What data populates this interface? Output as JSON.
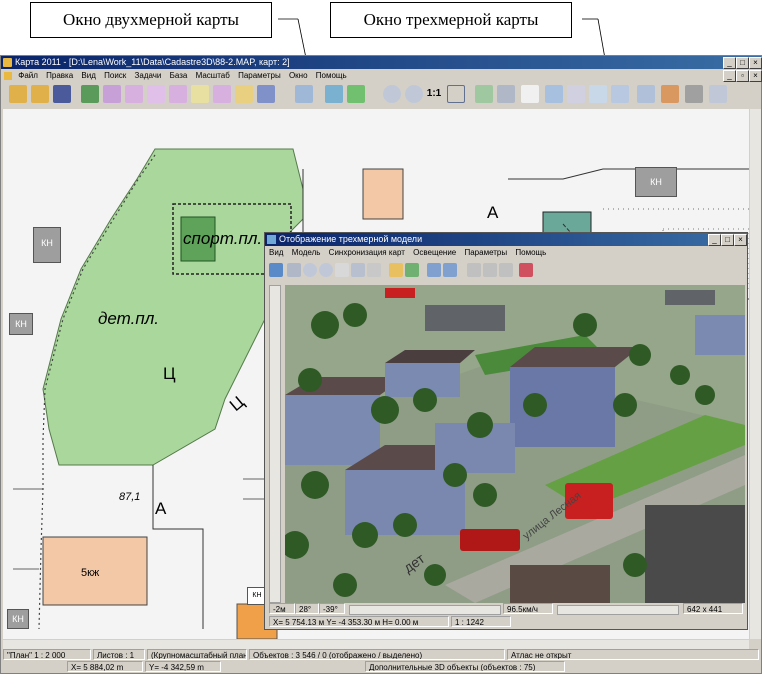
{
  "callouts": {
    "map2d": "Окно двухмерной карты",
    "map3d": "Окно трехмерной карты"
  },
  "main_window": {
    "title": "Карта 2011 - [D:\\Lena\\Work_11\\Data\\Cadastre3D\\88-2.MAP, карт: 2]",
    "menu": [
      "Файл",
      "Правка",
      "Вид",
      "Поиск",
      "Задачи",
      "База",
      "Масштаб",
      "Параметры",
      "Окно",
      "Помощь"
    ],
    "toolbar_scale_label": "1:1",
    "map_labels": {
      "sport": "спорт.пл.",
      "det": "дет.пл.",
      "c1": "Ц",
      "c2": "Ц",
      "a1": "А",
      "a2": "А",
      "a3": "А",
      "a4": "А",
      "b1": "Б",
      "height": "87,1",
      "bldg": "5кж",
      "kn": [
        "КН",
        "КН",
        "КН",
        "КН",
        "КН"
      ]
    },
    "status": {
      "mode": "\"План\"  1 : 2 000",
      "sheets": "Листов : 1",
      "plan": "(Крупномасштабный план)",
      "objects": "Объектов : 3 546 / 0 (отображено / выделено)",
      "atlas": "Атлас не открыт",
      "x": "X=     5 884,02 m",
      "y": "Y=   -4 342,59 m",
      "extra": "Дополнительные 3D объекты   (объектов : 75)"
    }
  },
  "window_3d": {
    "title": "Отображение трехмерной модели",
    "menu": [
      "Вид",
      "Модель",
      "Синхронизация карт",
      "Освещение",
      "Параметры",
      "Помощь"
    ],
    "angles": [
      "-2м",
      "28°",
      "-39°"
    ],
    "speed": "96.5км/ч",
    "size": "642 x 441",
    "coords": "X= 5 754.13 м   Y= -4 353.30 м   H= 0.00 м",
    "scale": "1 : 1242",
    "scene_labels": {
      "street": "улица Лесная",
      "det": "дет"
    }
  },
  "colors": {
    "title_blue": "#0a246a",
    "park_green": "#a9d79c",
    "building_tan": "#f2c8a6",
    "kn_gray": "#9e9e9e"
  }
}
